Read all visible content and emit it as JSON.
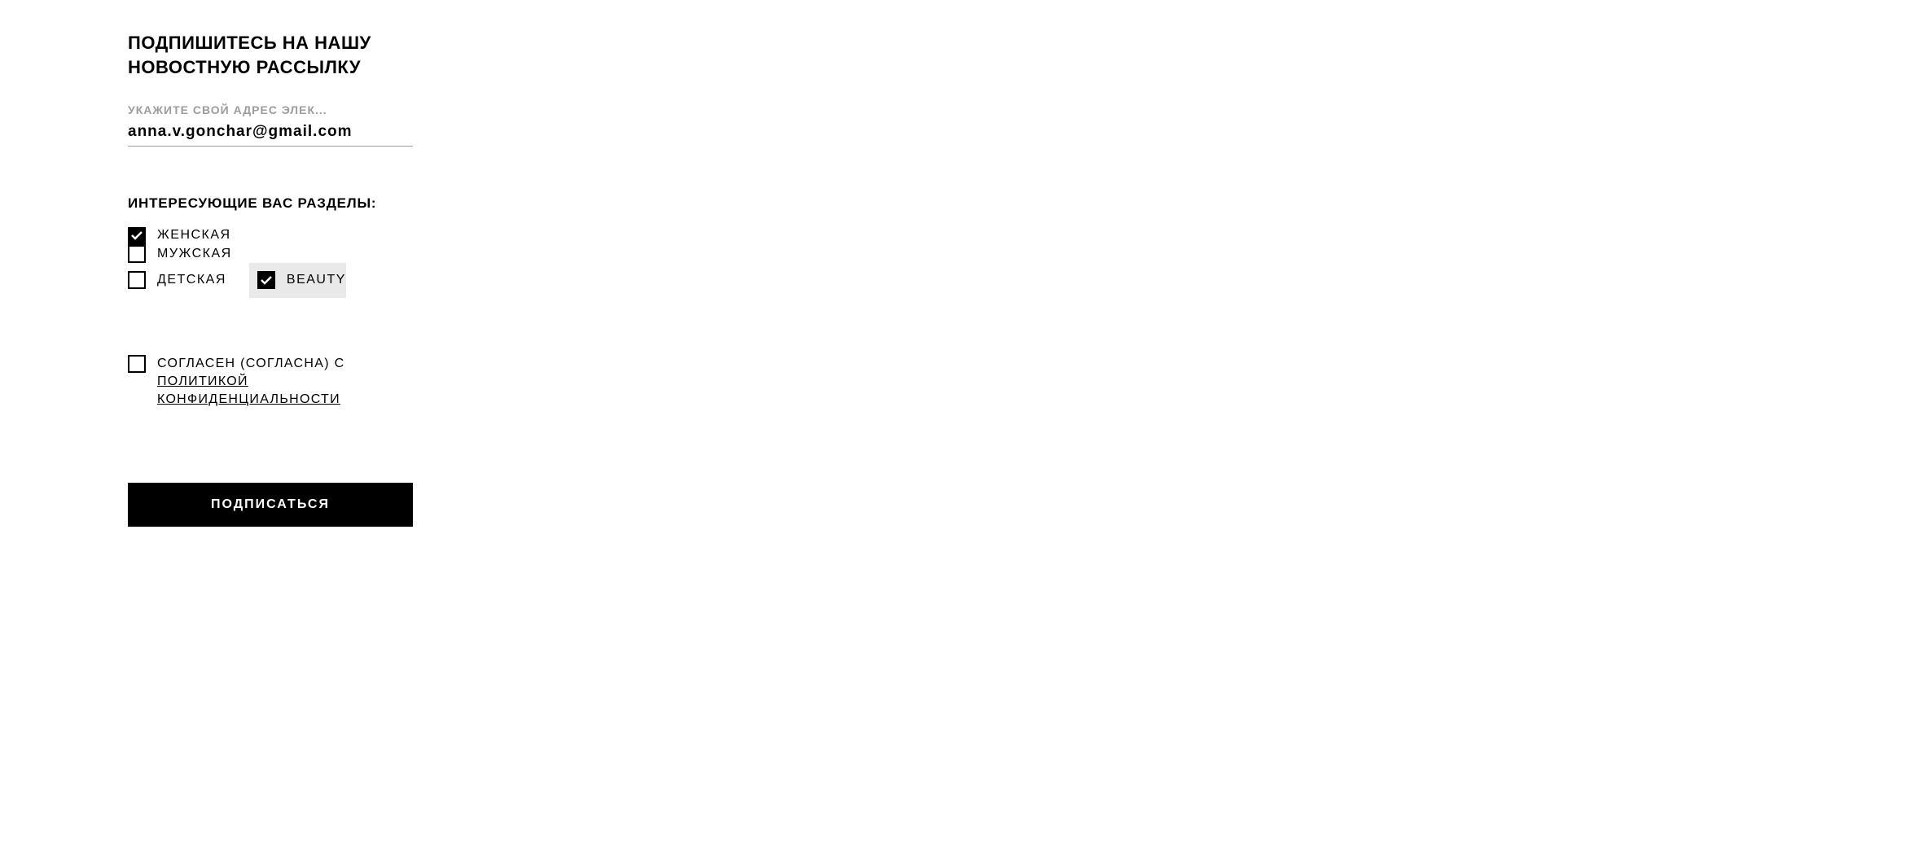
{
  "title": "ПОДПИШИТЕСЬ НА НАШУ НОВОСТНУЮ РАССЫЛКУ",
  "email": {
    "label": "УКАЖИТЕ СВОЙ АДРЕС ЭЛЕК...",
    "value": "anna.v.gonchar@gmail.com"
  },
  "sections": {
    "title": "ИНТЕРЕСУЮЩИЕ ВАС РАЗДЕЛЫ:",
    "items": [
      {
        "label": "ЖЕНСКАЯ",
        "checked": true
      },
      {
        "label": "МУЖСКАЯ",
        "checked": false
      },
      {
        "label": "ДЕТСКАЯ",
        "checked": false
      },
      {
        "label": "BEAUTY",
        "checked": true
      }
    ]
  },
  "consent": {
    "prefix": "СОГЛАСЕН (СОГЛАСНА) С ",
    "link": "ПОЛИТИКОЙ КОНФИДЕНЦИАЛЬНОСТИ",
    "checked": false
  },
  "subscribe_button": "ПОДПИСАТЬСЯ"
}
